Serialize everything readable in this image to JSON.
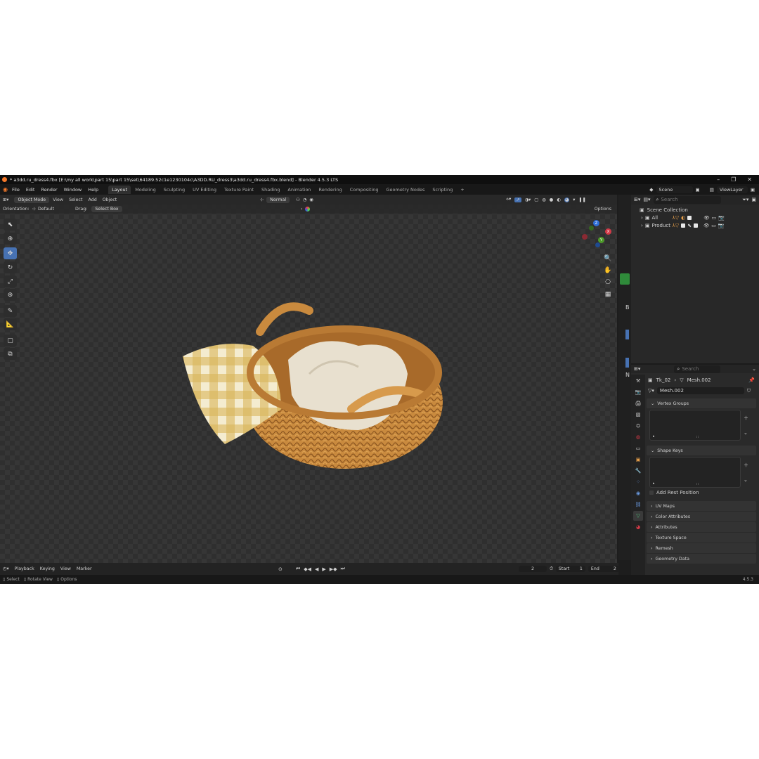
{
  "title": "* a3dd.ru_dress4.fbx [E:\\my all work\\part 15\\part 15\\set\\64189.52c1e1230104c\\A3DD.RU_dress3\\a3dd.ru_dress4.fbx.blend] - Blender 4.5.3 LTS",
  "window_controls": [
    "–",
    "❐",
    "✕"
  ],
  "menus": [
    "File",
    "Edit",
    "Render",
    "Window",
    "Help"
  ],
  "workspaces": [
    "Layout",
    "Modeling",
    "Sculpting",
    "UV Editing",
    "Texture Paint",
    "Shading",
    "Animation",
    "Rendering",
    "Compositing",
    "Geometry Nodes",
    "Scripting"
  ],
  "add_workspace": "+",
  "scene": {
    "label": "Scene",
    "viewlayer": "ViewLayer"
  },
  "viewport_header": {
    "mode": "Object Mode",
    "menus": [
      "View",
      "Select",
      "Add",
      "Object"
    ],
    "orientation_label": "Normal"
  },
  "tool_settings": {
    "orientation_label": "Orientation:",
    "orientation_value": "Default",
    "drag_label": "Drag:",
    "drag_value": "Select Box",
    "options": "Options"
  },
  "outliner": {
    "search_placeholder": "Search",
    "scene_collection": "Scene Collection",
    "items": [
      {
        "name": "All"
      },
      {
        "name": "Product"
      }
    ]
  },
  "properties": {
    "search_placeholder": "Search",
    "breadcrumb_object": "Tk_02",
    "breadcrumb_mesh": "Mesh.002",
    "mesh_name": "Mesh.002",
    "panels": {
      "vertex_groups": "Vertex Groups",
      "shape_keys": "Shape Keys",
      "add_rest_position": "Add Rest Position",
      "collapsed": [
        "UV Maps",
        "Color Attributes",
        "Attributes",
        "Texture Space",
        "Remesh",
        "Geometry Data"
      ]
    }
  },
  "side_letters": {
    "b": "B",
    "n": "N"
  },
  "timeline": {
    "menus": [
      "Playback",
      "Keying",
      "View",
      "Marker"
    ],
    "current_frame": "2",
    "start_label": "Start",
    "start_value": "1",
    "end_label": "End",
    "end_value": "2"
  },
  "status": {
    "items": [
      "Select",
      "Rotate View",
      "Options"
    ],
    "version": "4.5.3"
  },
  "gizmo": {
    "z": "Z",
    "x": "X",
    "y": "Y"
  },
  "colors": {
    "accent": "#4772b3",
    "logo": "#f5792a",
    "basket": "#c98a3e"
  }
}
